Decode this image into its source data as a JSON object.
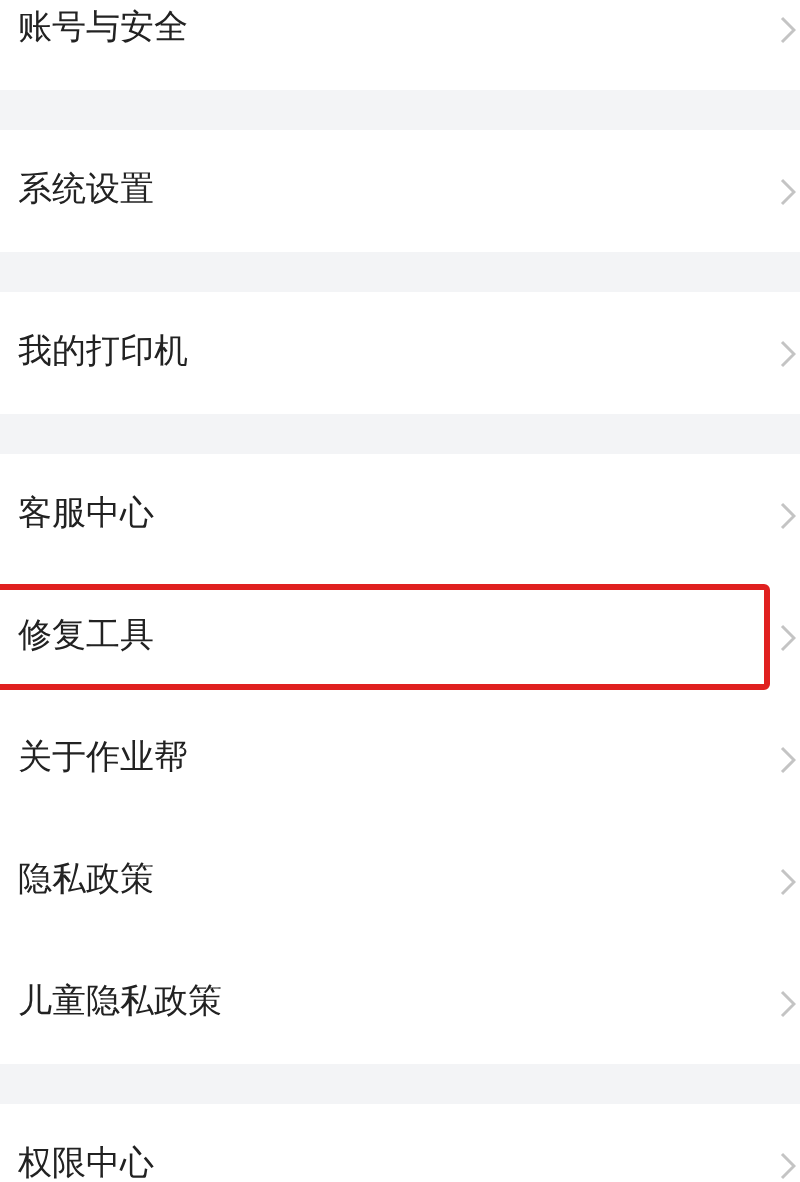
{
  "groups": [
    {
      "items": [
        {
          "label": "账号与安全",
          "highlighted": false
        }
      ]
    },
    {
      "items": [
        {
          "label": "系统设置",
          "highlighted": false
        }
      ]
    },
    {
      "items": [
        {
          "label": "我的打印机",
          "highlighted": false
        }
      ]
    },
    {
      "items": [
        {
          "label": "客服中心",
          "highlighted": false
        },
        {
          "label": "修复工具",
          "highlighted": true
        },
        {
          "label": "关于作业帮",
          "highlighted": false
        },
        {
          "label": "隐私政策",
          "highlighted": false
        },
        {
          "label": "儿童隐私政策",
          "highlighted": false
        }
      ]
    },
    {
      "items": [
        {
          "label": "权限中心",
          "highlighted": false
        }
      ]
    }
  ]
}
